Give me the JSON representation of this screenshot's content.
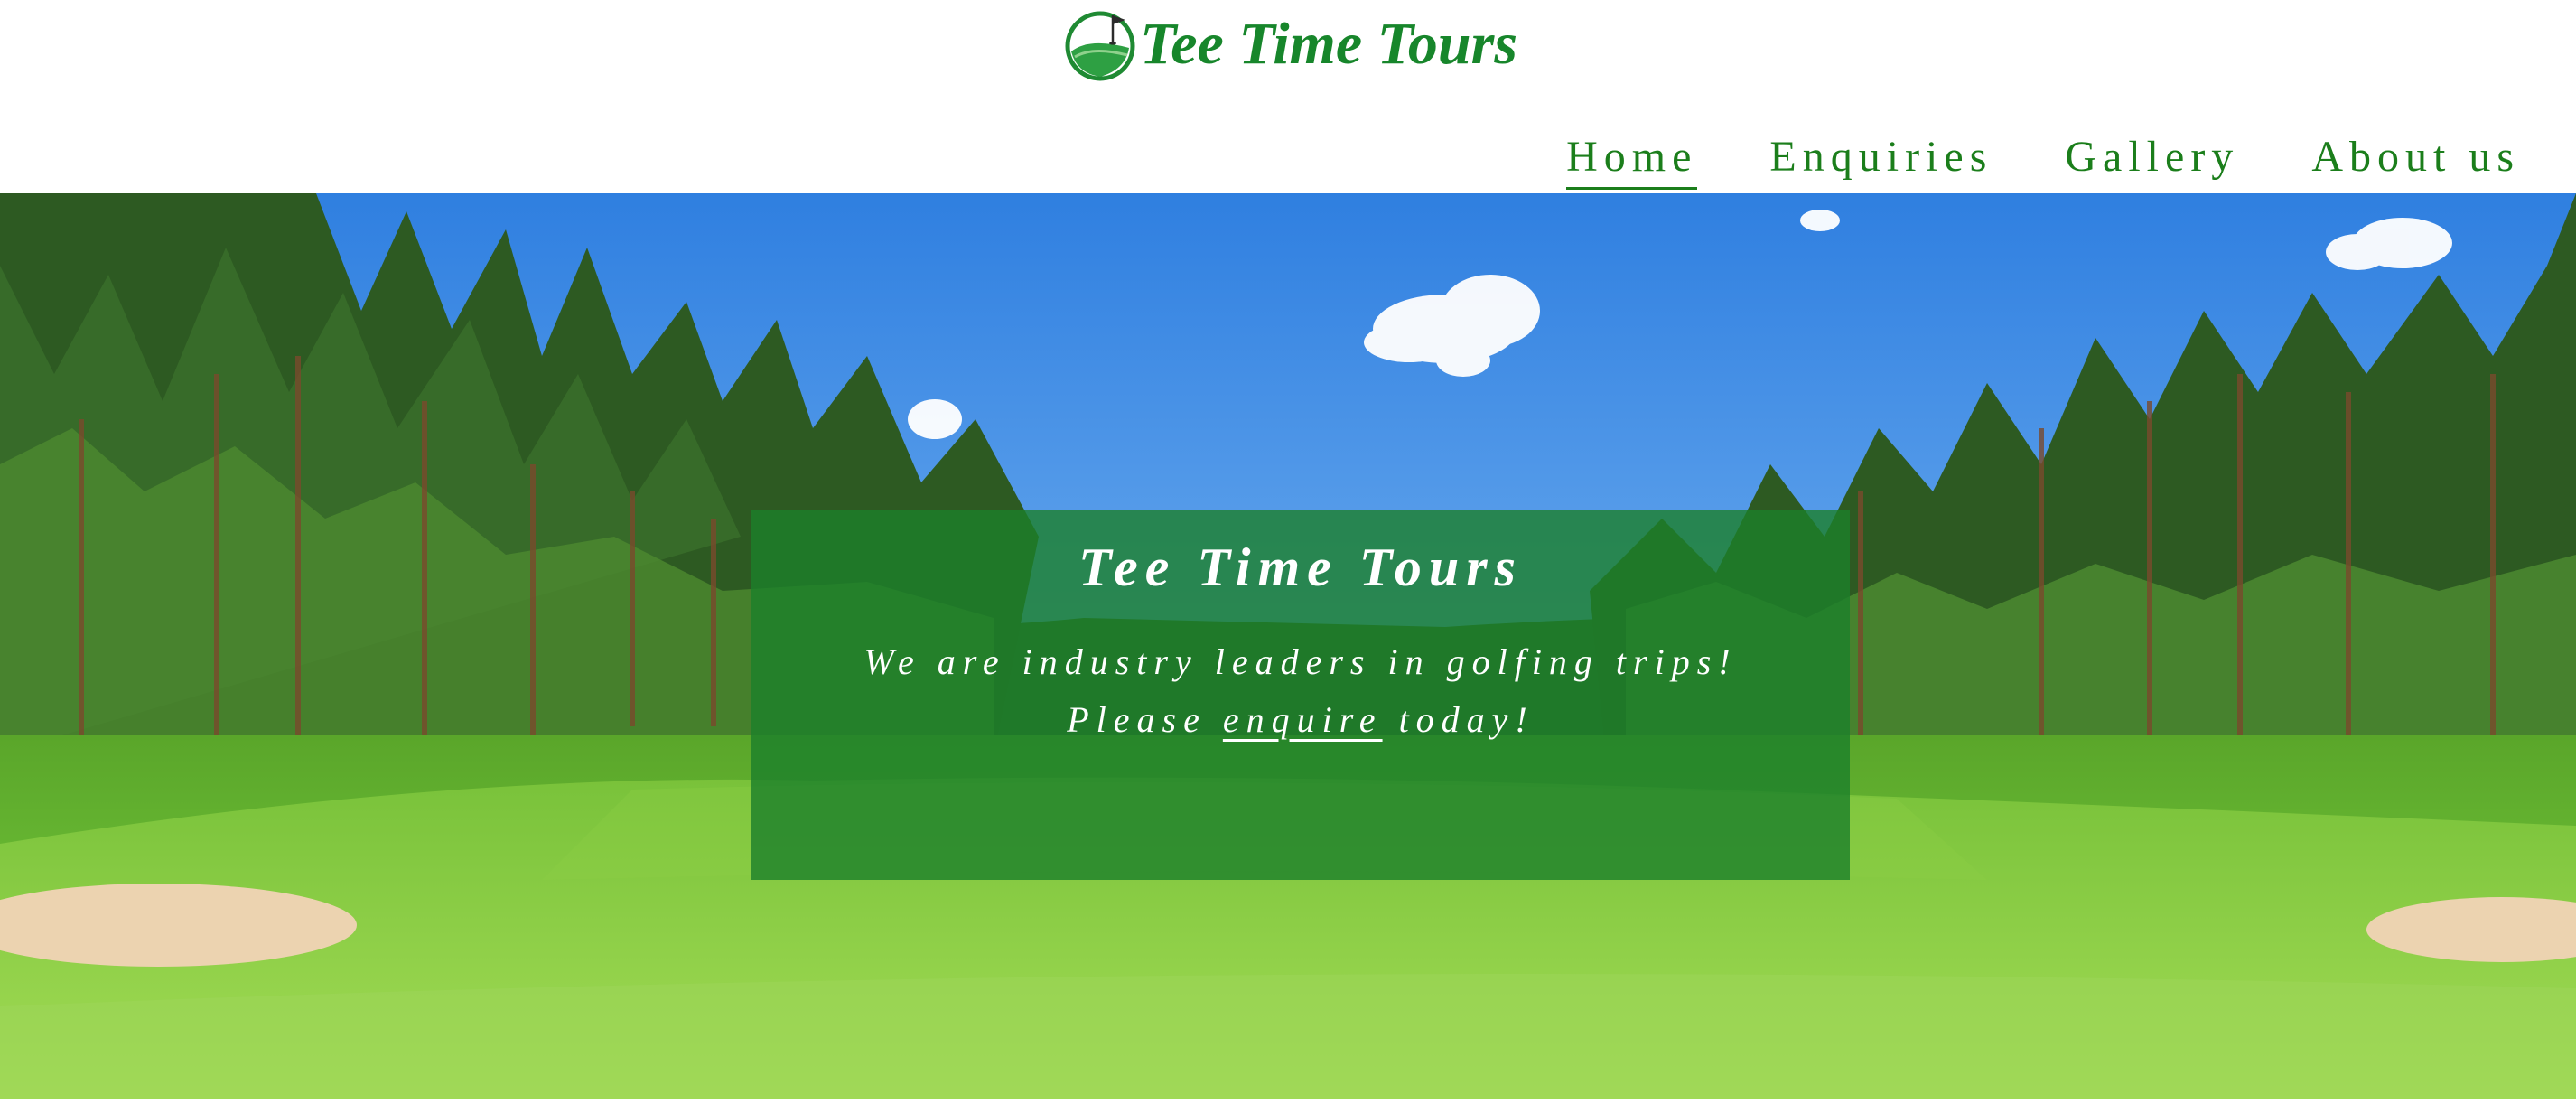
{
  "brand": {
    "name": "Tee Time Tours",
    "logo_icon": "golf-flag-logo-icon",
    "color": "#17862b"
  },
  "nav": {
    "items": [
      {
        "label": "Home",
        "active": true
      },
      {
        "label": "Enquiries",
        "active": false
      },
      {
        "label": "Gallery",
        "active": false
      },
      {
        "label": "About us",
        "active": false
      }
    ],
    "color": "#1b7e1b"
  },
  "hero": {
    "background": "golf-course-scene",
    "title": "Tee Time Tours",
    "line1": "We are industry leaders in golfing trips!",
    "line2_before": "Please",
    "line2_link": "enquire",
    "line2_after": "today!",
    "card_color": "#1c802a"
  }
}
